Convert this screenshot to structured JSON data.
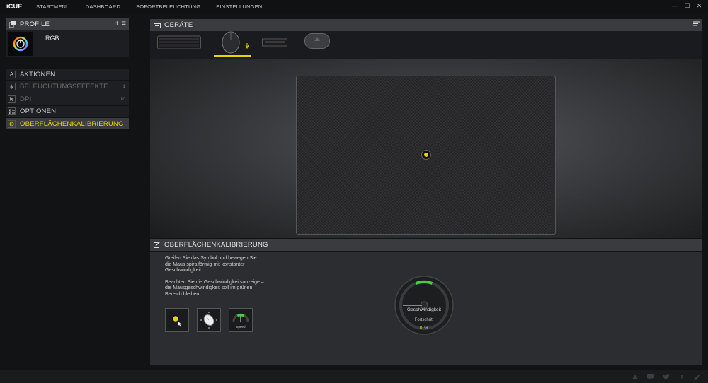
{
  "app": {
    "logo": "iCUE"
  },
  "nav": {
    "items": [
      "STARTMENÜ",
      "DASHBOARD",
      "SOFORTBELEUCHTUNG",
      "EINSTELLUNGEN"
    ]
  },
  "window": {
    "minimize": "—",
    "maximize": "☐",
    "close": "✕"
  },
  "profiles": {
    "title": "PROFILE",
    "add_label": "+",
    "menu_label": "≡",
    "current": {
      "name": "RGB",
      "icon": "power-rgb-icon"
    }
  },
  "menu": {
    "items": [
      {
        "label": "AKTIONEN",
        "icon": "letter-a-icon",
        "count": "",
        "state": "normal"
      },
      {
        "label": "BELEUCHTUNGSEFFEKTE",
        "icon": "lightning-icon",
        "count": "1",
        "state": "dim"
      },
      {
        "label": "DPI",
        "icon": "dpi-icon",
        "count": "10",
        "state": "dim"
      },
      {
        "label": "OPTIONEN",
        "icon": "options-icon",
        "count": "",
        "state": "normal"
      },
      {
        "label": "OBERFLÄCHENKALIBRIERUNG",
        "icon": "surface-icon",
        "count": "",
        "state": "active"
      }
    ]
  },
  "devices": {
    "title": "GERÄTE",
    "items": [
      "keyboard-device",
      "mouse-device",
      "ram-device",
      "headset-stand-device"
    ],
    "selected": "mouse-device"
  },
  "calibration": {
    "title": "OBERFLÄCHENKALIBRIERUNG",
    "instruction_1": "Greifen Sie das Symbol und bewegen Sie die Maus spiralförmig mit konstanter Geschwindigkeit.",
    "instruction_2": "Beachten Sie die Geschwindigkeitsanzeige – die Mausgeschwindigkeit soll im grünen Bereich bleiben.",
    "step_3_label": "Speed",
    "speed_label": "Geschwindigkeit",
    "progress_label": "Fortschritt",
    "progress_value": "0",
    "progress_unit": "%"
  },
  "colors": {
    "accent": "#e7d400",
    "green": "#3fd23f",
    "panel": "#3a3b3e"
  }
}
